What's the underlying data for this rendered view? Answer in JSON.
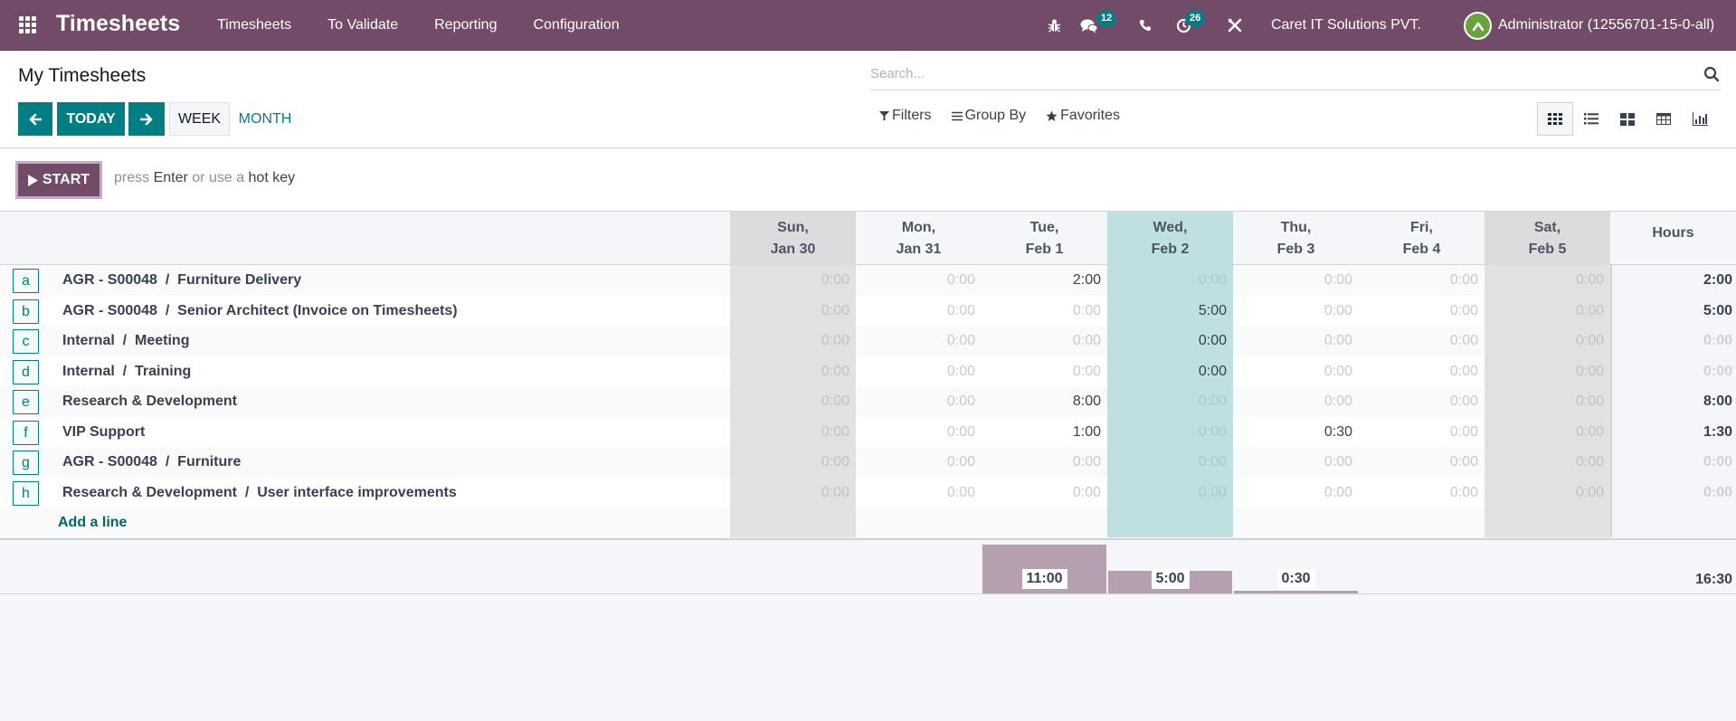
{
  "navbar": {
    "app_title": "Timesheets",
    "menu": [
      "Timesheets",
      "To Validate",
      "Reporting",
      "Configuration"
    ],
    "messages_badge": "12",
    "activities_badge": "26",
    "company": "Caret IT Solutions PVT.",
    "user": "Administrator (12556701-15-0-all)",
    "avatar_initial": "A",
    "icons": [
      "apps-icon",
      "bug-icon",
      "chat-icon",
      "phone-icon",
      "clock-icon",
      "tools-icon"
    ]
  },
  "control_panel": {
    "title": "My Timesheets",
    "prev_label": "←",
    "today_label": "TODAY",
    "next_label": "→",
    "week_label": "WEEK",
    "month_label": "MONTH",
    "search_placeholder": "Search...",
    "filters_label": "Filters",
    "groupby_label": "Group By",
    "favorites_label": "Favorites",
    "views": [
      "grid",
      "list",
      "kanban",
      "pivot",
      "graph"
    ],
    "active_view": "grid"
  },
  "start_bar": {
    "start_label": "START",
    "hint_prefix": "press ",
    "hint_key": "Enter",
    "hint_middle": " or use a ",
    "hint_suffix": "hot key"
  },
  "grid": {
    "columns": [
      {
        "day": "Sun,",
        "date": "Jan 30",
        "type": "weekend"
      },
      {
        "day": "Mon,",
        "date": "Jan 31",
        "type": "normal"
      },
      {
        "day": "Tue,",
        "date": "Feb 1",
        "type": "normal"
      },
      {
        "day": "Wed,",
        "date": "Feb 2",
        "type": "today"
      },
      {
        "day": "Thu,",
        "date": "Feb 3",
        "type": "normal"
      },
      {
        "day": "Fri,",
        "date": "Feb 4",
        "type": "normal"
      },
      {
        "day": "Sat,",
        "date": "Feb 5",
        "type": "weekend"
      }
    ],
    "hours_header": "Hours",
    "rows": [
      {
        "hotkey": "a",
        "label": "AGR - S00048  /  Furniture Delivery",
        "values": [
          "0:00",
          "0:00",
          "2:00",
          "0:00",
          "0:00",
          "0:00",
          "0:00"
        ],
        "total": "2:00"
      },
      {
        "hotkey": "b",
        "label": "AGR - S00048  /  Senior Architect (Invoice on Timesheets)",
        "values": [
          "0:00",
          "0:00",
          "0:00",
          "5:00",
          "0:00",
          "0:00",
          "0:00"
        ],
        "total": "5:00"
      },
      {
        "hotkey": "c",
        "label": "Internal  /  Meeting",
        "values": [
          "0:00",
          "0:00",
          "0:00",
          "0:00",
          "0:00",
          "0:00",
          "0:00"
        ],
        "total": "0:00",
        "highlight_today": true
      },
      {
        "hotkey": "d",
        "label": "Internal  /  Training",
        "values": [
          "0:00",
          "0:00",
          "0:00",
          "0:00",
          "0:00",
          "0:00",
          "0:00"
        ],
        "total": "0:00",
        "highlight_today": true
      },
      {
        "hotkey": "e",
        "label": "Research & Development",
        "values": [
          "0:00",
          "0:00",
          "8:00",
          "0:00",
          "0:00",
          "0:00",
          "0:00"
        ],
        "total": "8:00"
      },
      {
        "hotkey": "f",
        "label": "VIP Support",
        "values": [
          "0:00",
          "0:00",
          "1:00",
          "0:00",
          "0:30",
          "0:00",
          "0:00"
        ],
        "total": "1:30"
      },
      {
        "hotkey": "g",
        "label": "AGR - S00048  /  Furniture",
        "values": [
          "0:00",
          "0:00",
          "0:00",
          "0:00",
          "0:00",
          "0:00",
          "0:00"
        ],
        "total": "0:00"
      },
      {
        "hotkey": "h",
        "label": "Research & Development  /  User interface improvements",
        "values": [
          "0:00",
          "0:00",
          "0:00",
          "0:00",
          "0:00",
          "0:00",
          "0:00"
        ],
        "total": "0:00"
      }
    ],
    "add_line_label": "Add a line",
    "footer": {
      "daily_totals": [
        "",
        "",
        "11:00",
        "5:00",
        "0:30",
        "",
        ""
      ],
      "daily_hours": [
        0,
        0,
        11,
        5,
        0.5,
        0,
        0
      ],
      "grand_total": "16:30"
    }
  },
  "colors": {
    "brand": "#714b67",
    "accent": "#017e84",
    "today_column": "#bfdfe0",
    "weekend_column": "#dcdcdf",
    "footer_bar": "#b4a0b0"
  }
}
